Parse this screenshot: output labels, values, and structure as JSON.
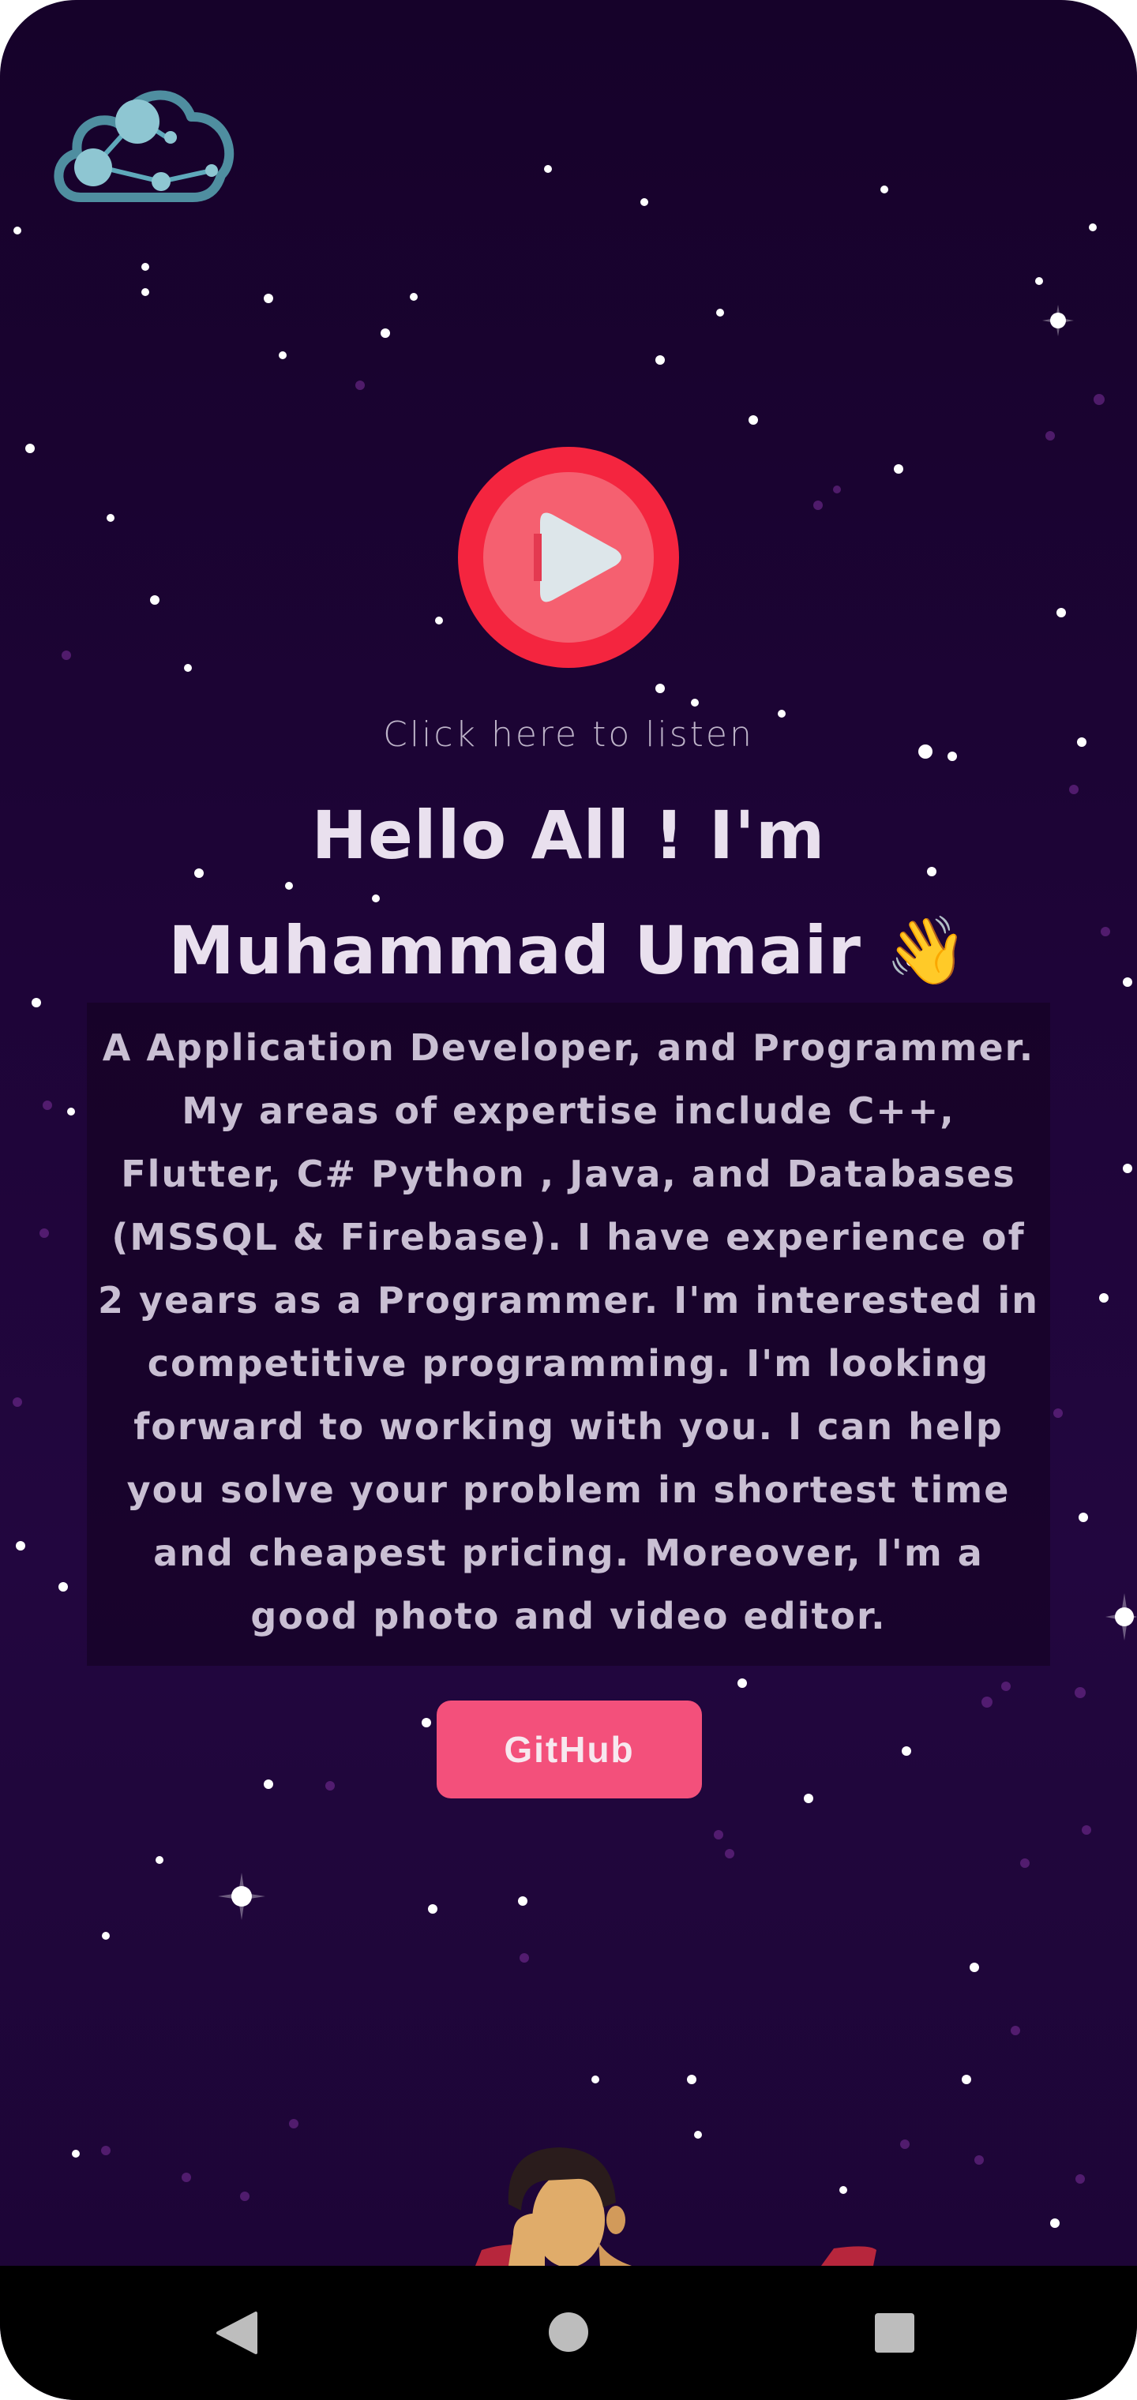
{
  "hero": {
    "listen_label": "Click here to listen",
    "greeting": "Hello All ! I'm Muhammad Umair 👋",
    "about": "A Application Developer, and Programmer. My areas of expertise include C++, Flutter, C# Python , Java, and Databases (MSSQL & Firebase). I have experience of 2 years as a Programmer. I'm interested in competitive programming. I'm looking forward to working with you. I can help you solve your problem in shortest time and cheapest pricing. Moreover, I'm a good photo and video editor.",
    "github_label": "GitHub"
  },
  "icons": {
    "logo": "cloud-network-icon",
    "play": "play-icon",
    "nav_back": "back-triangle-icon",
    "nav_home": "home-circle-icon",
    "nav_recents": "recents-square-icon"
  },
  "colors": {
    "background": "#1d0436",
    "play_outer": "#f4253f",
    "play_inner": "#f56070",
    "github_button": "#f3507b",
    "text": "#e9e0ee",
    "logo": "#5fa9bb"
  }
}
